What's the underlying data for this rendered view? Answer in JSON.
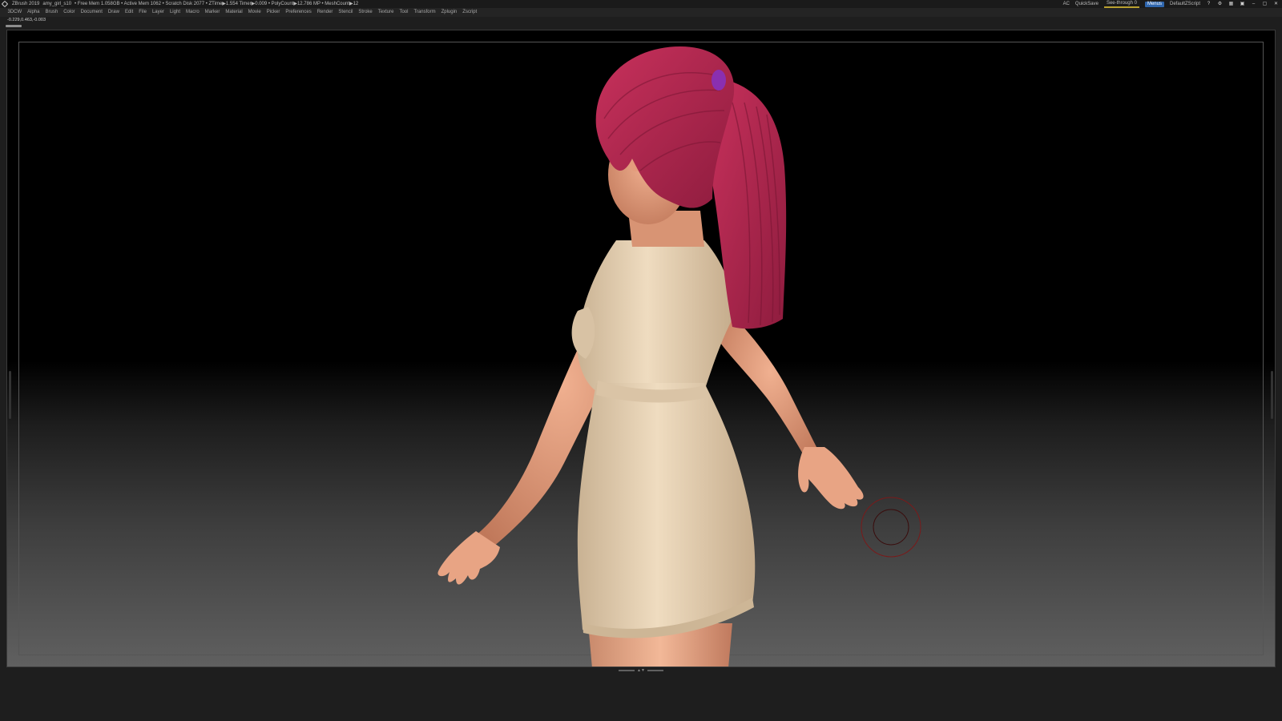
{
  "titlebar": {
    "app": "ZBrush 2019",
    "file": "amy_girl_s10",
    "stats": "• Free Mem 1.058GB • Active Mem 1062 • Scratch Disk 2077 • ZTime▶1.554 Timer▶0.009 • PolyCount▶12.786 MP • MeshCount▶12",
    "ac": "AC",
    "quicksave": "QuickSave",
    "see_through": "See-through  0",
    "menus": "Menus",
    "script": "DefaultZScript"
  },
  "menu": {
    "items": [
      "3DCW",
      "Alpha",
      "Brush",
      "Color",
      "Document",
      "Draw",
      "Edit",
      "File",
      "Layer",
      "Light",
      "Macro",
      "Marker",
      "Material",
      "Movie",
      "Picker",
      "Preferences",
      "Render",
      "Stencil",
      "Stroke",
      "Texture",
      "Tool",
      "Transform",
      "Zplugin",
      "Zscript"
    ]
  },
  "coords": "-0.229,0.463,-0.003",
  "colors": {
    "hair": "#b0264f",
    "skin": "#e09a7a",
    "dress": "#e2cdb0",
    "scrunchie": "#8a2fb0",
    "accent": "#2f66ad"
  },
  "icons": [
    "help-icon",
    "settings-icon",
    "layout-icon",
    "minimize-icon",
    "restore-icon",
    "close-icon"
  ]
}
